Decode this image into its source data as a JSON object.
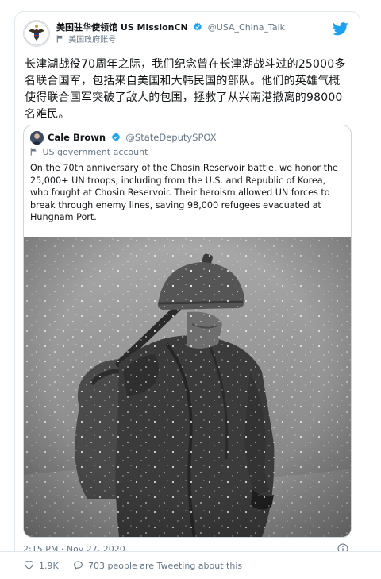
{
  "tweet": {
    "display_name": "美国驻华使领馆 US MissionCN",
    "handle": "@USA_China_Talk",
    "account_label": "美国政府账号",
    "body": "长津湖战役70周年之际，我们纪念曾在长津湖战斗过的25000多名联合国军，包括来自美国和大韩民国的部队。他们的英雄气概使得联合国军突破了敌人的包围，拯救了从兴南港撤离的98000名难民。",
    "timestamp": "2:15 PM · Nov 27, 2020",
    "likes": "1.9K",
    "tweeting_about": "703 people are Tweeting about this"
  },
  "quoted": {
    "display_name": "Cale Brown",
    "handle": "@StateDeputySPOX",
    "account_label": "US government account",
    "body": "On the 70th anniversary of the Chosin Reservoir battle, we honor the 25,000+ UN troops, including from the U.S. and Republic of Korea, who fought at Chosin Reservoir. Their heroism allowed UN forces to break through enemy lines, saving 98,000 refugees evacuated at Hungnam Port."
  },
  "icons": {
    "verified": "verified-badge-icon",
    "bird": "twitter-bird-icon",
    "flag": "government-flag-icon",
    "info": "info-icon",
    "heart": "heart-icon",
    "reply": "reply-bubble-icon"
  },
  "colors": {
    "twitter_blue": "#1da1f2",
    "secondary_text": "#657786",
    "border": "#e1e8ed"
  }
}
